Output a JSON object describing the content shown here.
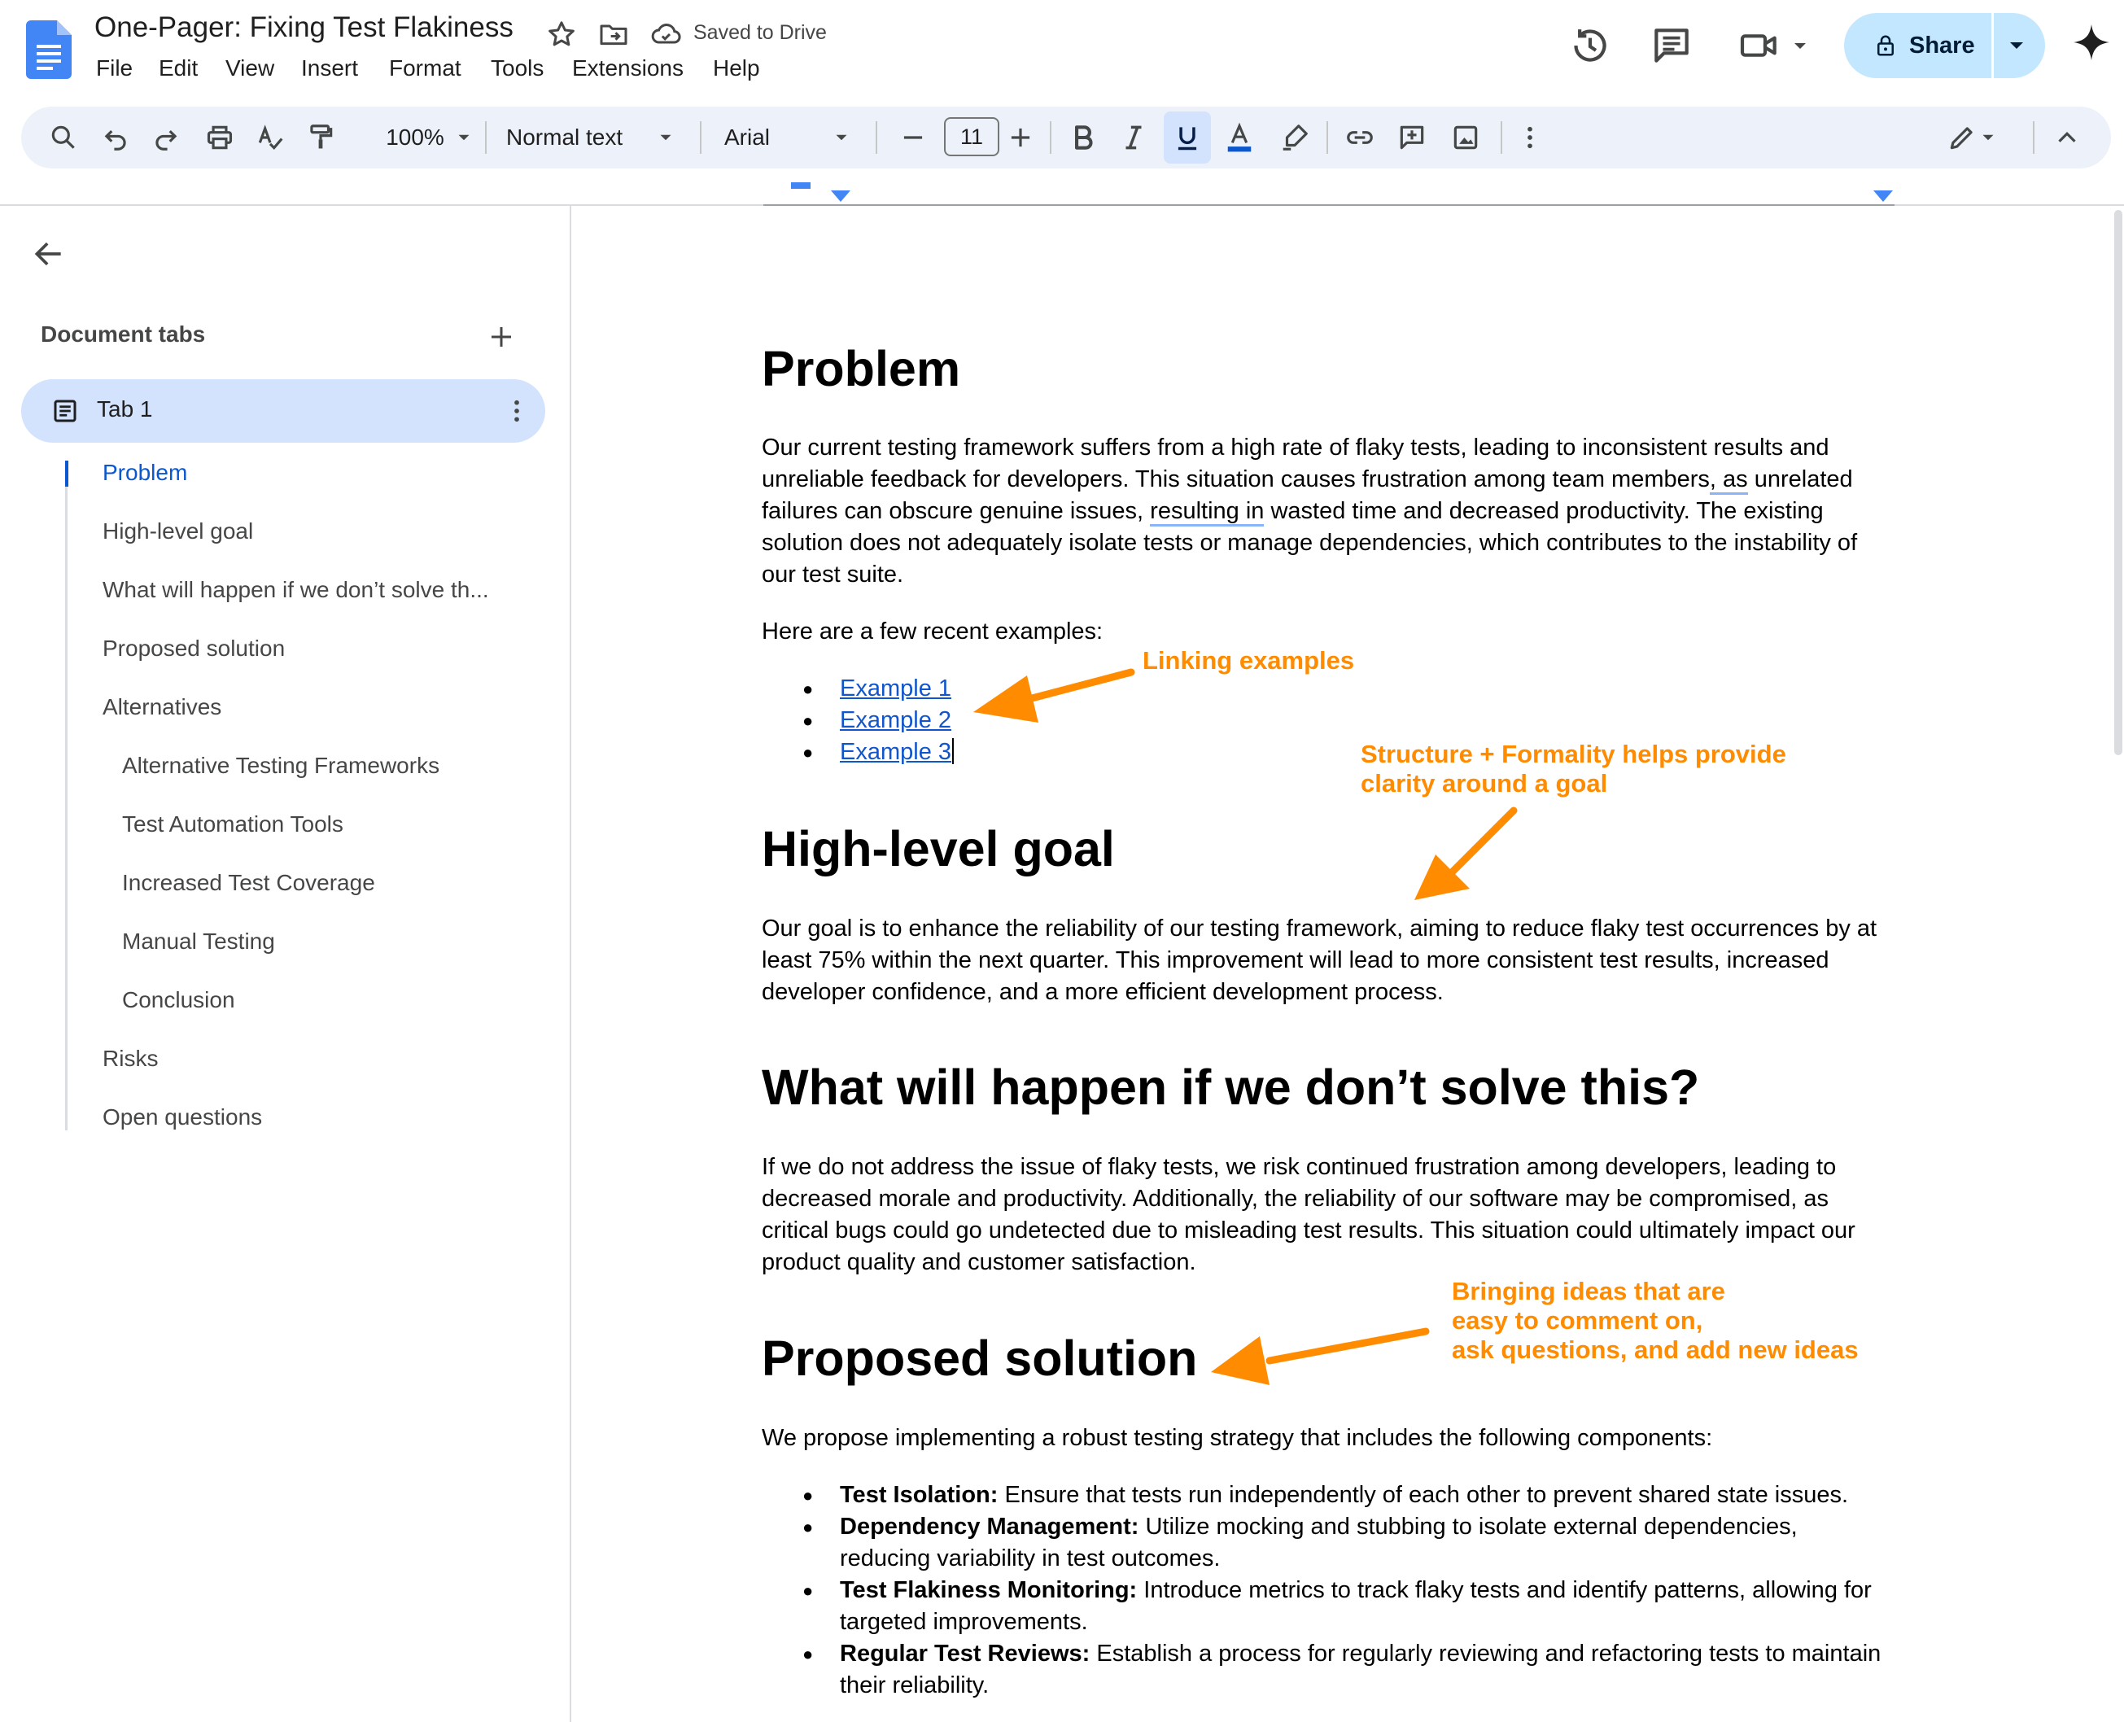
{
  "header": {
    "title": "One-Pager: Fixing Test Flakiness",
    "saved_status": "Saved to Drive",
    "menu": [
      "File",
      "Edit",
      "View",
      "Insert",
      "Format",
      "Tools",
      "Extensions",
      "Help"
    ],
    "share_label": "Share"
  },
  "toolbar": {
    "zoom": "100%",
    "style": "Normal text",
    "font": "Arial",
    "font_size": "11"
  },
  "sidebar": {
    "heading": "Document tabs",
    "tab_label": "Tab 1",
    "outline": [
      "Problem",
      "High-level goal",
      "What will happen if we don’t solve th...",
      "Proposed solution",
      "Alternatives",
      "Alternative Testing Frameworks",
      "Test Automation Tools",
      "Increased Test Coverage",
      "Manual Testing",
      "Conclusion",
      "Risks",
      "Open questions"
    ]
  },
  "document": {
    "problem": {
      "heading": "Problem",
      "line1": "Our current testing framework suffers from a high rate of flaky tests, leading to inconsistent results and",
      "line2a": "unreliable feedback for developers. This situation causes frustration among team members",
      "line2b": ", as",
      "line2c": " unrelated",
      "line3a": "failures can obscure genuine issues, ",
      "line3b": "resulting in",
      "line3c": " wasted time and decreased productivity. The existing",
      "line4": "solution does not adequately isolate tests or manage dependencies, which contributes to the instability of",
      "line5": "our test suite.",
      "examples_intro": "Here are a few recent examples:",
      "examples": [
        "Example 1",
        "Example 2",
        "Example 3"
      ]
    },
    "goal": {
      "heading": "High-level goal",
      "text": "Our goal is to enhance the reliability of our testing framework, aiming to reduce flaky test occurrences by at least 75% within the next quarter. This improvement will lead to more consistent test results, increased developer confidence, and a more efficient development process."
    },
    "risk": {
      "heading": "What will happen if we don’t solve this?",
      "text": "If we do not address the issue of flaky tests, we risk continued frustration among developers, leading to decreased morale and productivity. Additionally, the reliability of our software may be compromised, as critical bugs could go undetected due to misleading test results. This situation could ultimately impact our product quality and customer satisfaction."
    },
    "solution": {
      "heading": "Proposed solution",
      "intro": "We propose implementing a robust testing strategy that includes the following components:",
      "items": [
        {
          "term": "Test Isolation:",
          "text": " Ensure that tests run independently of each other to prevent shared state issues."
        },
        {
          "term": "Dependency Management:",
          "text": " Utilize mocking and stubbing to isolate external dependencies, reducing variability in test outcomes."
        },
        {
          "term": "Test Flakiness Monitoring:",
          "text": " Introduce metrics to track flaky tests and identify patterns, allowing for targeted improvements."
        },
        {
          "term": "Regular Test Reviews:",
          "text": " Establish a process for regularly reviewing and refactoring tests to maintain their reliability."
        }
      ]
    }
  },
  "annotations": {
    "linking": "Linking examples",
    "structure_1": "Structure + Formality helps provide",
    "structure_2": "clarity around a goal",
    "ideas_1": "Bringing ideas that are",
    "ideas_2": "easy to comment on,",
    "ideas_3": "ask questions, and add new ideas",
    "color": "#ff8c00"
  },
  "colors": {
    "accent": "#0b57d0",
    "share_bg": "#c2e7ff",
    "toolbar_bg": "#edf2fa",
    "tab_active_bg": "#d3e3fd",
    "link": "#1155cc",
    "docs_blue": "#4285f4"
  }
}
